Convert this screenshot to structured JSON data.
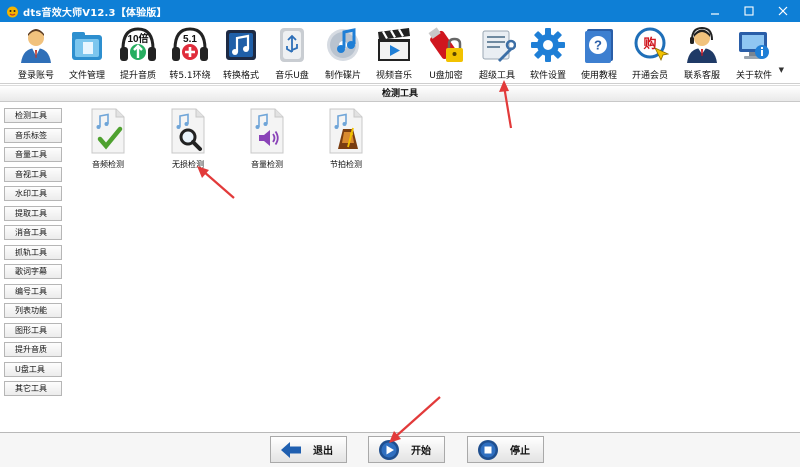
{
  "window": {
    "title": "dts音效大师V12.3【体验版】",
    "controls": [
      "minimize",
      "maximize",
      "close"
    ]
  },
  "toolbar": {
    "items": [
      {
        "label": "登录账号",
        "icon": "user-login-icon"
      },
      {
        "label": "文件管理",
        "icon": "folder-icon"
      },
      {
        "label": "提升音质",
        "icon": "headphones-10x-icon",
        "badge": "10倍"
      },
      {
        "label": "转5.1环绕",
        "icon": "headphones-51-icon",
        "badge": "5.1"
      },
      {
        "label": "转换格式",
        "icon": "music-note-convert-icon"
      },
      {
        "label": "音乐U盘",
        "icon": "usb-drive-icon"
      },
      {
        "label": "制作碟片",
        "icon": "cd-music-icon"
      },
      {
        "label": "视频音乐",
        "icon": "clapperboard-icon"
      },
      {
        "label": "U盘加密",
        "icon": "usb-lock-icon"
      },
      {
        "label": "超级工具",
        "icon": "toolbox-icon"
      },
      {
        "label": "软件设置",
        "icon": "gear-icon"
      },
      {
        "label": "使用教程",
        "icon": "help-book-icon"
      },
      {
        "label": "开通会员",
        "icon": "buy-vip-icon",
        "badge": "购"
      },
      {
        "label": "联系客服",
        "icon": "customer-service-icon"
      },
      {
        "label": "关于软件",
        "icon": "computer-about-icon"
      }
    ]
  },
  "section": {
    "title": "检测工具"
  },
  "sidebar": {
    "items": [
      {
        "label": "检测工具"
      },
      {
        "label": "音乐标签"
      },
      {
        "label": "音量工具"
      },
      {
        "label": "音视工具"
      },
      {
        "label": "水印工具"
      },
      {
        "label": "提取工具"
      },
      {
        "label": "消音工具"
      },
      {
        "label": "抓轨工具"
      },
      {
        "label": "歌词字幕"
      },
      {
        "label": "编号工具"
      },
      {
        "label": "列表功能"
      },
      {
        "label": "图形工具"
      },
      {
        "label": "提升音质"
      },
      {
        "label": "U盘工具"
      },
      {
        "label": "其它工具"
      }
    ]
  },
  "tools": [
    {
      "label": "音频检测",
      "icon": "audio-check-icon"
    },
    {
      "label": "无损检测",
      "icon": "lossless-check-icon"
    },
    {
      "label": "音量检测",
      "icon": "volume-check-icon"
    },
    {
      "label": "节拍检测",
      "icon": "beat-check-icon"
    }
  ],
  "footer": {
    "exit_label": "退出",
    "start_label": "开始",
    "stop_label": "停止"
  },
  "colors": {
    "titlebar": "#0e7fd6",
    "annotation_arrow": "#e23a3a"
  }
}
